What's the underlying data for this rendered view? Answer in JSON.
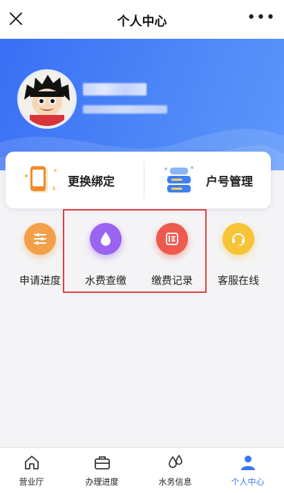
{
  "topbar": {
    "title": "个人中心"
  },
  "card": {
    "left_label": "更换绑定",
    "right_label": "户号管理"
  },
  "grid": [
    {
      "label": "申请进度",
      "color": "#f2a04a"
    },
    {
      "label": "水费查缴",
      "color": "#9a63f0"
    },
    {
      "label": "缴费记录",
      "color": "#ee5a4d"
    },
    {
      "label": "客服在线",
      "color": "#f6c436"
    }
  ],
  "tabs": [
    {
      "label": "营业厅"
    },
    {
      "label": "办理进度"
    },
    {
      "label": "水务信息"
    },
    {
      "label": "个人中心",
      "active": true
    }
  ],
  "colors": {
    "accent": "#3a78f2",
    "highlight": "#e53a3a"
  }
}
